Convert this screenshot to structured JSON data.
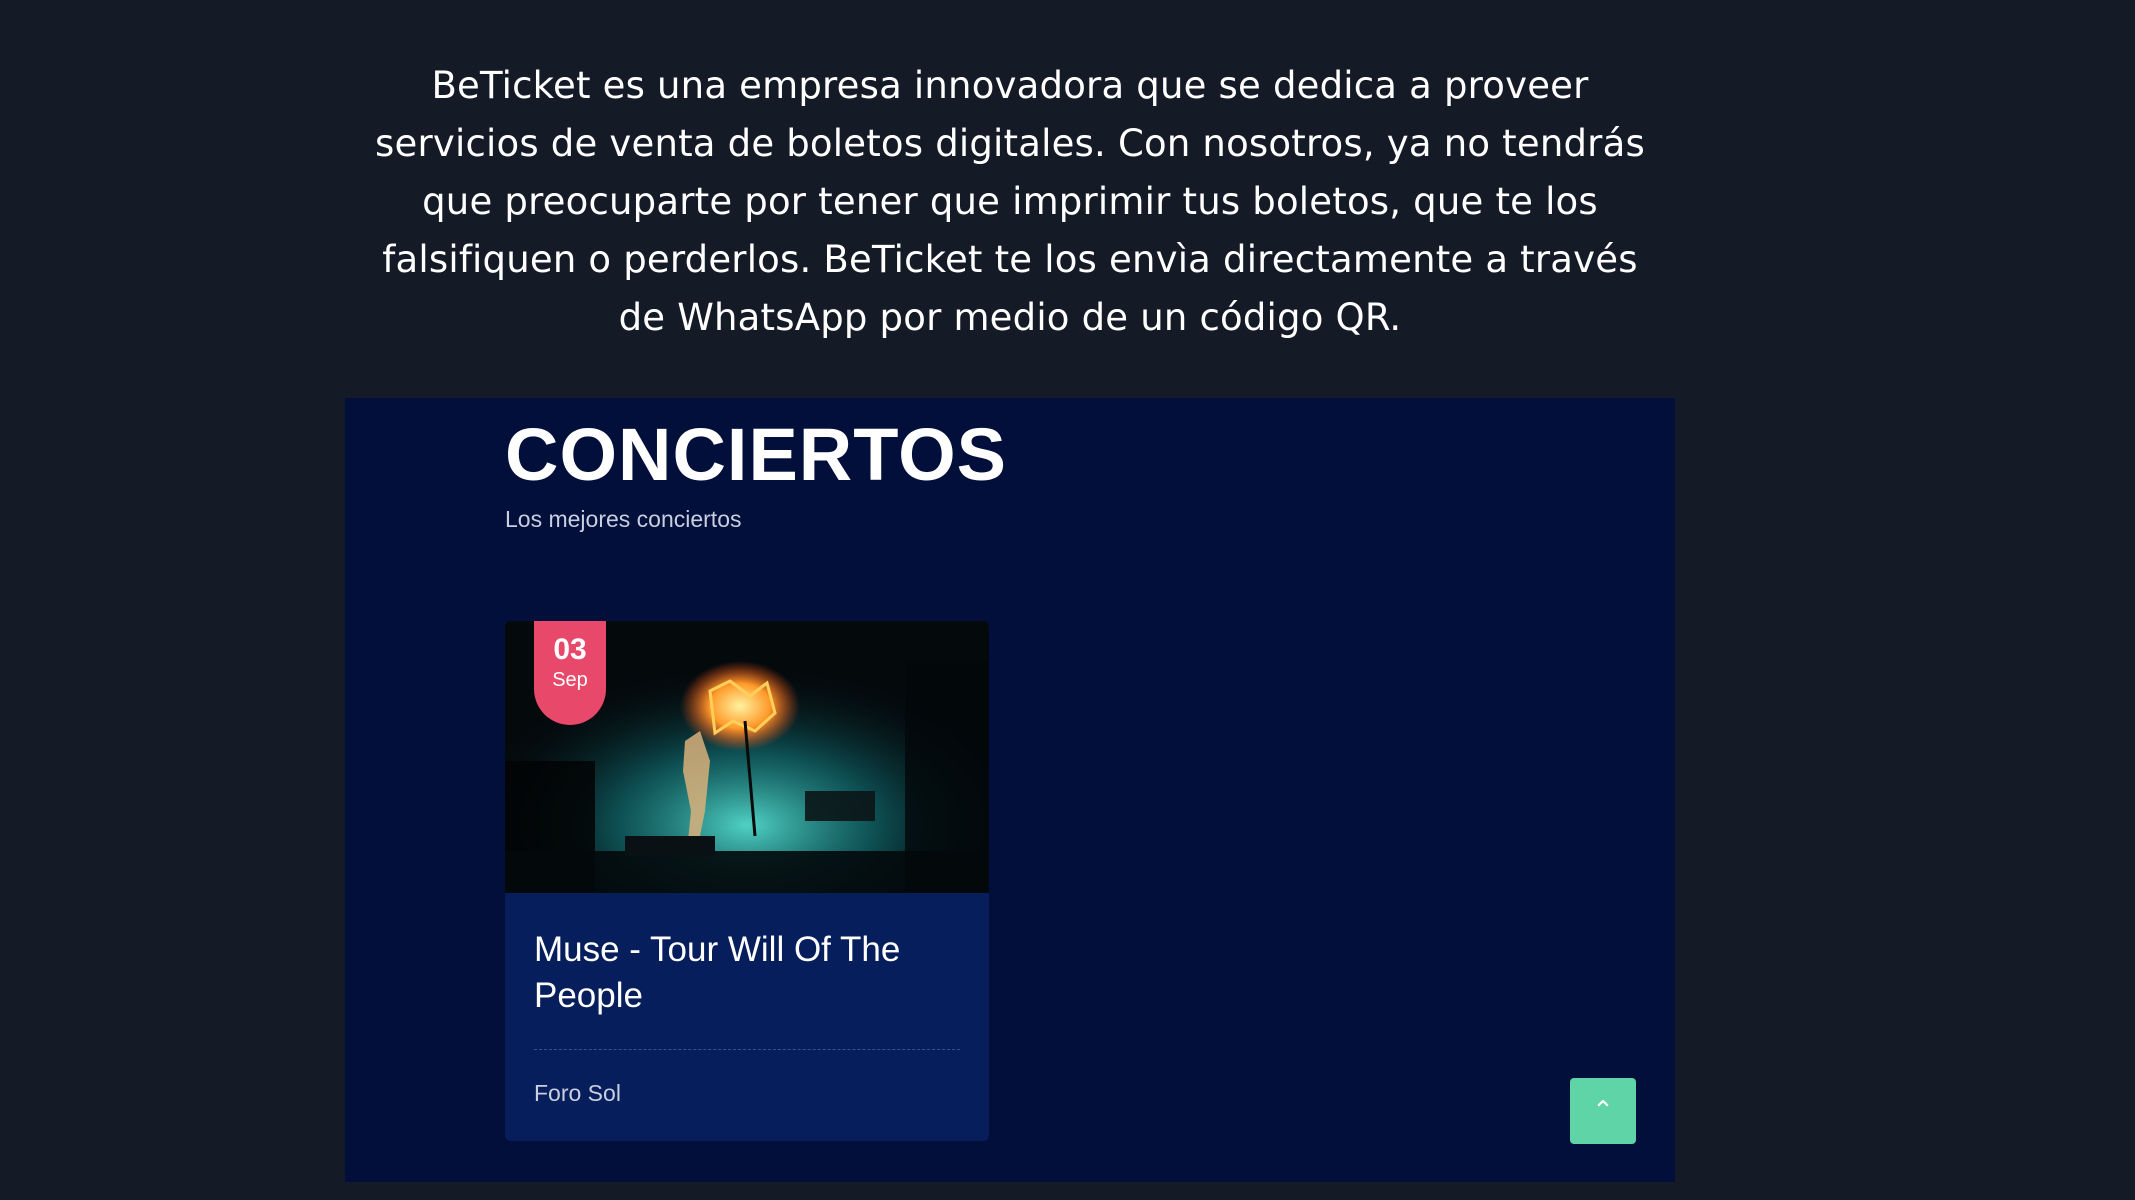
{
  "intro": {
    "text": "BeTicket es una empresa innovadora que se dedica a proveer servicios de venta de boletos digitales. Con nosotros, ya no tendrás que preocuparte por tener que imprimir tus boletos, que te los falsifiquen o perderlos. BeTicket te los envìa directamente a través de WhatsApp por medio de un código QR."
  },
  "section": {
    "title": "CONCIERTOS",
    "subtitle": "Los mejores conciertos"
  },
  "events": [
    {
      "day": "03",
      "month": "Sep",
      "title": "Muse - Tour Will Of The People",
      "venue": "Foro Sol"
    }
  ],
  "scroll_top": {
    "icon": "chevron-up-icon",
    "symbol": "⌃"
  },
  "colors": {
    "page_bg": "#151a27",
    "panel_bg": "#010f3a",
    "card_bg": "#061e5b",
    "badge": "#e8486a",
    "scroll_button": "#5fd4a6"
  }
}
